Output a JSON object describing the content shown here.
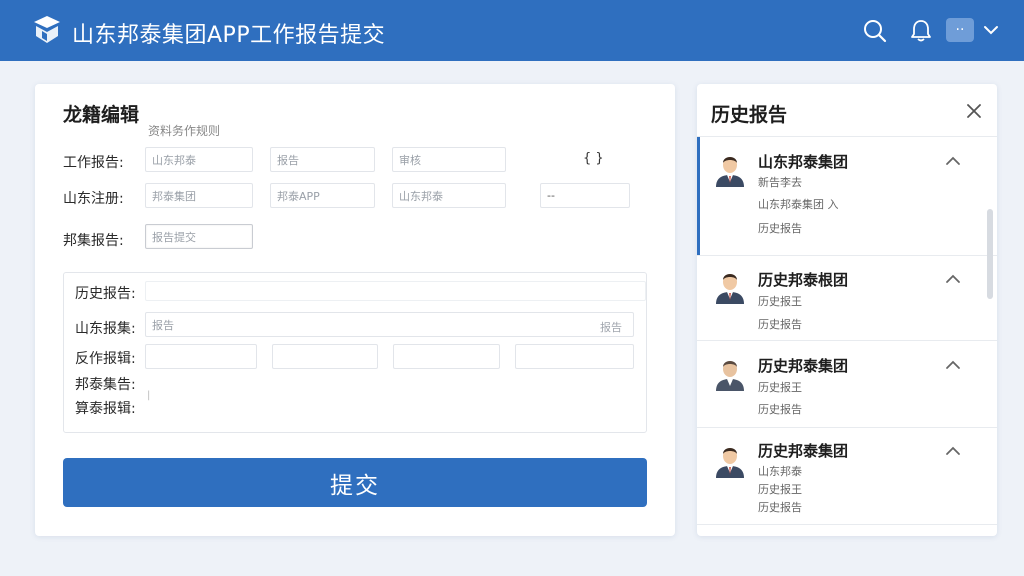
{
  "header": {
    "title": "山东邦泰集团APP工作报告提交",
    "more_label": "··"
  },
  "form": {
    "title": "龙籍编辑",
    "subtitle": "资料务作规则",
    "rows": [
      {
        "label": "工作报告:",
        "fields": [
          {
            "value": "山东邦泰"
          },
          {
            "value": "报告"
          },
          {
            "value": "审核"
          }
        ]
      },
      {
        "label": "山东注册:",
        "fields": [
          {
            "value": "邦泰集团"
          },
          {
            "value": "邦泰APP"
          },
          {
            "value": "山东邦泰"
          },
          {
            "value": "--"
          }
        ]
      },
      {
        "label": "邦集报告:",
        "fields": [
          {
            "value": "报告提交"
          }
        ]
      }
    ],
    "bracket_text": "{   }",
    "subsection": {
      "rows": [
        {
          "label": "历史报告:",
          "fields": [
            {
              "value": ""
            }
          ]
        },
        {
          "label": "山东报集:",
          "fields": [
            {
              "value": "报告"
            }
          ],
          "trailing": "报告"
        },
        {
          "label": "反作报辑:",
          "fields": [
            {
              "value": ""
            },
            {
              "value": ""
            },
            {
              "value": ""
            },
            {
              "value": ""
            }
          ]
        },
        {
          "label": "邦泰集告:",
          "fields": []
        },
        {
          "label": "算泰报辑:",
          "fields": []
        }
      ],
      "mark": "|"
    },
    "submit_label": "提交"
  },
  "history": {
    "title": "历史报告",
    "items": [
      {
        "name": "山东邦泰集团",
        "lines": [
          "新告李去",
          "山东邦泰集团 入",
          "历史报告"
        ]
      },
      {
        "name": "历史邦泰根团",
        "lines": [
          "历史报王",
          "历史报告"
        ]
      },
      {
        "name": "历史邦泰集团",
        "lines": [
          "历史报王",
          "历史报告"
        ]
      },
      {
        "name": "历史邦泰集团",
        "lines": [
          "山东邦泰",
          "历史报王",
          "历史报告"
        ]
      }
    ]
  },
  "colors": {
    "brand_blue": "#2f6fbf",
    "background": "#eef2f8"
  }
}
